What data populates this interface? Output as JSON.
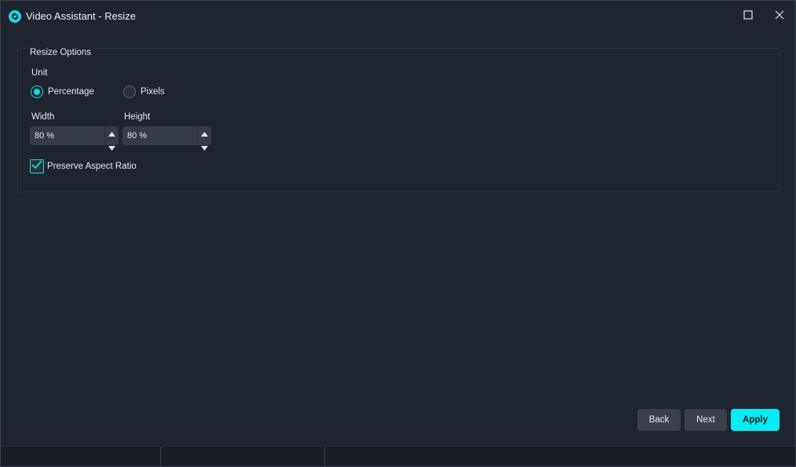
{
  "window": {
    "title": "Video Assistant - Resize",
    "icons": {
      "app": "app-logo-icon",
      "maximize": "maximize-icon",
      "close": "close-icon"
    }
  },
  "resize_options": {
    "group_title": "Resize Options",
    "unit_label": "Unit",
    "units": [
      {
        "label": "Percentage",
        "selected": true
      },
      {
        "label": "Pixels",
        "selected": false
      }
    ],
    "width": {
      "label": "Width",
      "value": "80 %"
    },
    "height": {
      "label": "Height",
      "value": "80 %"
    },
    "preserve_aspect_ratio": {
      "label": "Preserve Aspect Ratio",
      "checked": true
    }
  },
  "buttons": {
    "back": "Back",
    "next": "Next",
    "apply": "Apply"
  },
  "colors": {
    "accent": "#05ecf5",
    "background": "#1f252e",
    "control": "#353c47"
  }
}
